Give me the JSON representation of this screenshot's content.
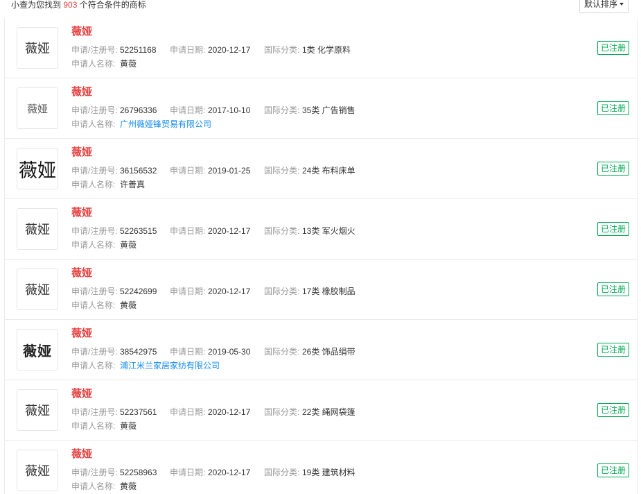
{
  "summary": {
    "prefix": "小查为您找到",
    "count": "903",
    "suffix": "个符合条件的商标"
  },
  "sort": {
    "label": "默认排序"
  },
  "labels": {
    "reg_no": "申请/注册号:",
    "date": "申请日期:",
    "class": "国际分类:",
    "applicant": "申请人名称:"
  },
  "items": [
    {
      "logo_text": "薇娅",
      "name": "薇娅",
      "reg_no": "52251168",
      "date": "2020-12-17",
      "class": "1类 化学原料",
      "applicant": "黄薇",
      "applicant_link": false,
      "status": "已注册"
    },
    {
      "logo_text": "薇娅",
      "name": "薇娅",
      "reg_no": "26796336",
      "date": "2017-10-10",
      "class": "35类 广告销售",
      "applicant": "广州薇娅锋贸易有限公司",
      "applicant_link": true,
      "status": "已注册"
    },
    {
      "logo_text": "薇娅",
      "name": "薇娅",
      "reg_no": "36156532",
      "date": "2019-01-25",
      "class": "24类 布料床单",
      "applicant": "许善真",
      "applicant_link": false,
      "status": "已注册"
    },
    {
      "logo_text": "薇娅",
      "name": "薇娅",
      "reg_no": "52263515",
      "date": "2020-12-17",
      "class": "13类 军火烟火",
      "applicant": "黄薇",
      "applicant_link": false,
      "status": "已注册"
    },
    {
      "logo_text": "薇娅",
      "name": "薇娅",
      "reg_no": "52242699",
      "date": "2020-12-17",
      "class": "17类 橡胶制品",
      "applicant": "黄薇",
      "applicant_link": false,
      "status": "已注册"
    },
    {
      "logo_text": "薇娅",
      "name": "薇娅",
      "reg_no": "38542975",
      "date": "2019-05-30",
      "class": "26类 饰品绢带",
      "applicant": "浦江米兰家居家纺有限公司",
      "applicant_link": true,
      "status": "已注册"
    },
    {
      "logo_text": "薇娅",
      "name": "薇娅",
      "reg_no": "52237561",
      "date": "2020-12-17",
      "class": "22类 绳网袋篷",
      "applicant": "黄薇",
      "applicant_link": false,
      "status": "已注册"
    },
    {
      "logo_text": "薇娅",
      "name": "薇娅",
      "reg_no": "52258963",
      "date": "2020-12-17",
      "class": "19类 建筑材料",
      "applicant": "黄薇",
      "applicant_link": false,
      "status": "已注册"
    }
  ],
  "colors": {
    "accent_red": "#e64141",
    "status_green": "#00a854",
    "link_blue": "#128bed"
  }
}
